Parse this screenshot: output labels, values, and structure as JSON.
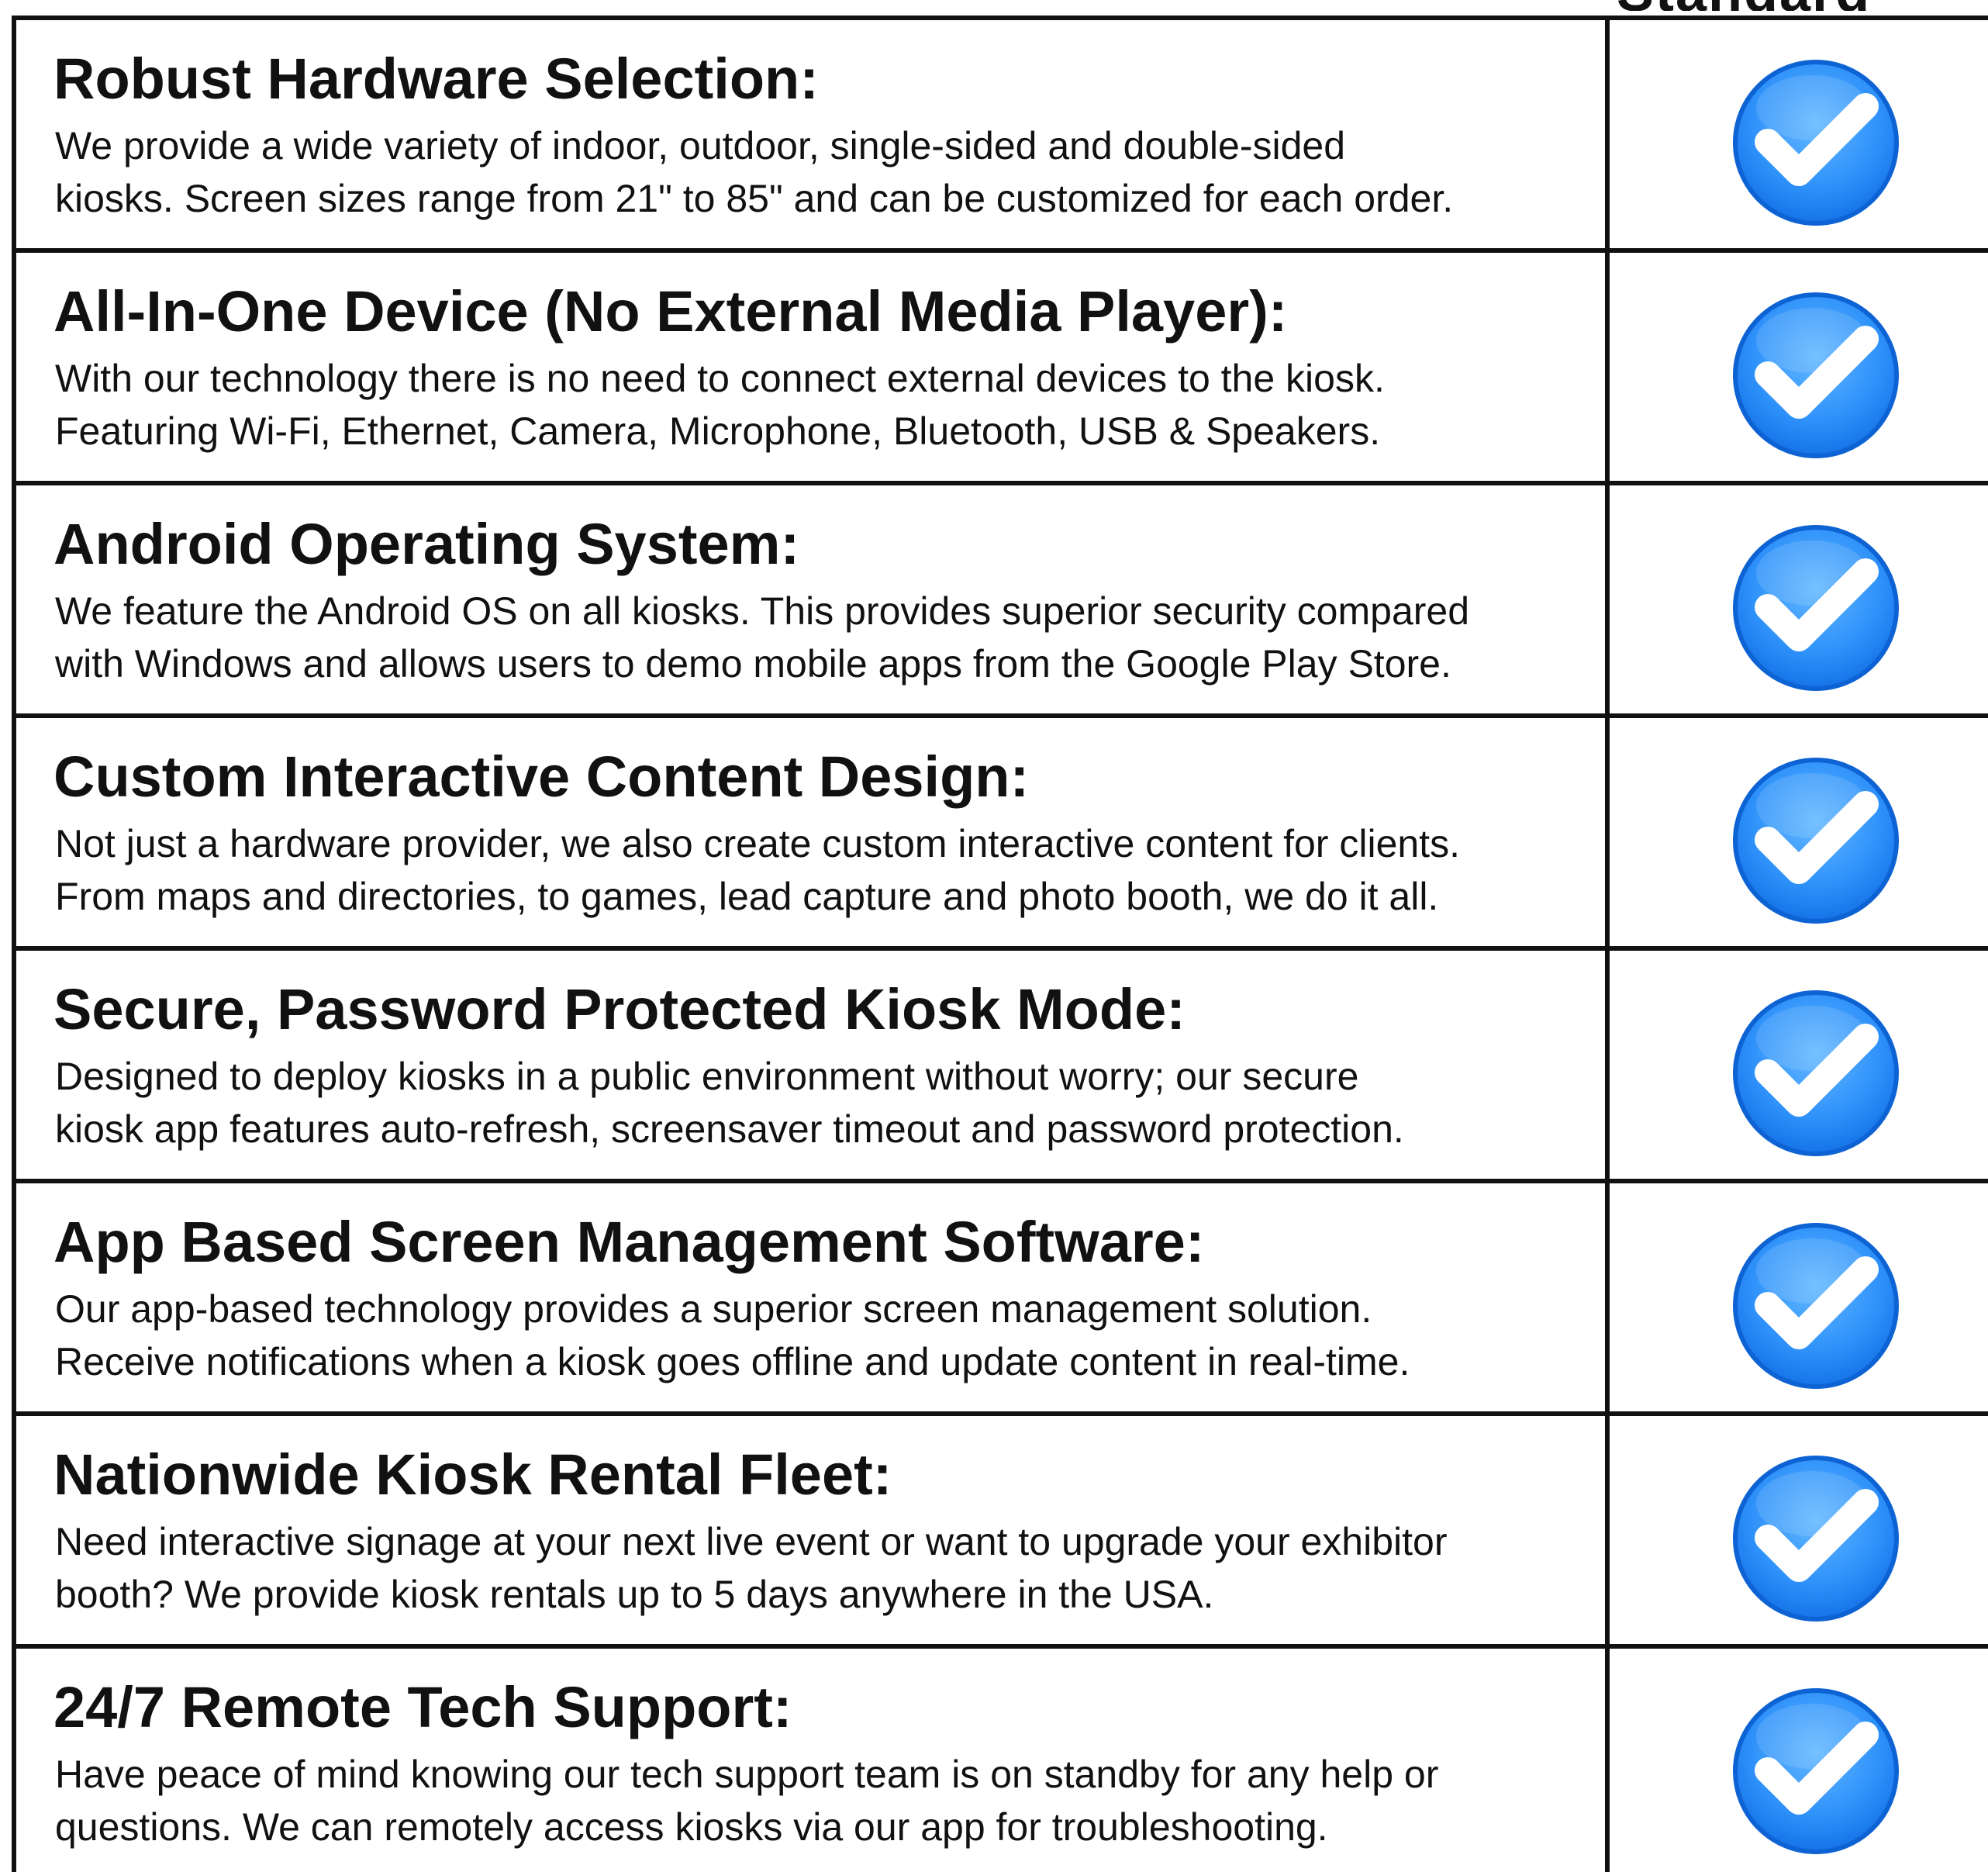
{
  "header": {
    "cut_off_text": "Standard"
  },
  "features": [
    {
      "title": "Robust Hardware Selection:",
      "description": "We provide a wide variety of indoor, outdoor, single-sided and double-sided\nkiosks. Screen sizes range from 21\" to 85\" and can be customized for each order.",
      "check_icon": "check-circle-icon"
    },
    {
      "title": "All-In-One Device (No External Media Player):",
      "description": "With our technology there is no need to connect external devices to the kiosk.\nFeaturing Wi-Fi, Ethernet, Camera, Microphone, Bluetooth, USB & Speakers.",
      "check_icon": "check-circle-icon"
    },
    {
      "title": "Android Operating System:",
      "description": "We feature the Android OS on all kiosks. This provides superior security compared\nwith Windows and allows users to demo mobile apps from the Google Play Store.",
      "check_icon": "check-circle-icon"
    },
    {
      "title": "Custom Interactive Content Design:",
      "description": "Not just a hardware provider, we also create custom interactive content for clients.\nFrom maps and directories, to games, lead capture and photo booth, we do it all.",
      "check_icon": "check-circle-icon"
    },
    {
      "title": "Secure, Password Protected Kiosk Mode:",
      "description": "Designed to deploy kiosks in a public environment without worry; our secure\nkiosk app features auto-refresh, screensaver timeout and password protection.",
      "check_icon": "check-circle-icon"
    },
    {
      "title": "App Based Screen Management Software:",
      "description": "Our app-based technology provides a superior screen management solution.\nReceive notifications when a kiosk goes offline and update content in real-time.",
      "check_icon": "check-circle-icon"
    },
    {
      "title": "Nationwide Kiosk Rental Fleet:",
      "description": "Need interactive signage at your next live event or want to upgrade your exhibitor\nbooth?  We provide kiosk rentals up to 5 days anywhere in the USA.",
      "check_icon": "check-circle-icon"
    },
    {
      "title": "24/7 Remote Tech Support:",
      "description": "Have peace of mind knowing our tech support team is on standby for any help or\nquestions. We can remotely access kiosks via our app for troubleshooting.",
      "check_icon": "check-circle-icon"
    }
  ],
  "colors": {
    "border": "#111111",
    "check_blue_light": "#46A7FF",
    "check_blue_dark": "#126FE4",
    "check_white": "#FFFFFF"
  }
}
